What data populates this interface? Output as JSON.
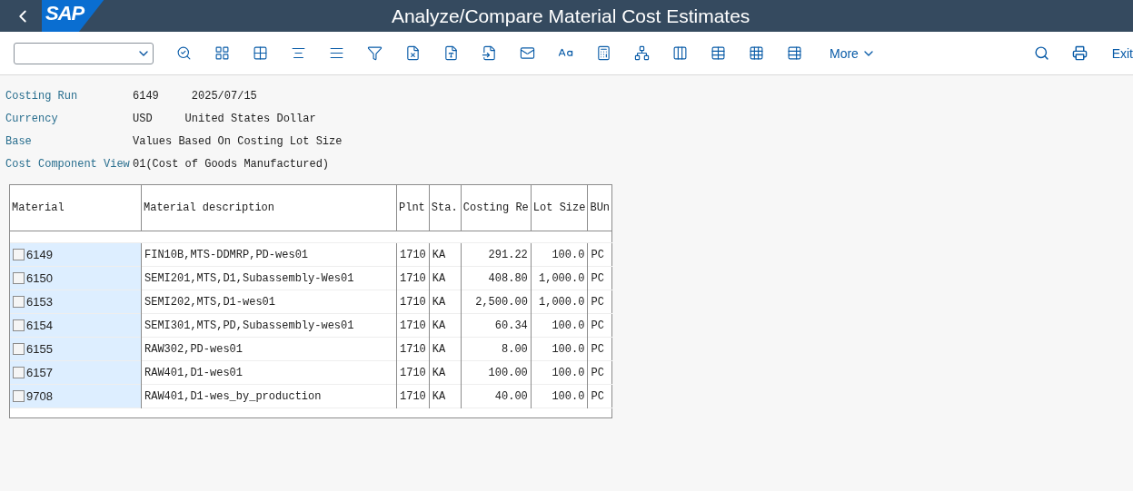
{
  "shell": {
    "title": "Analyze/Compare Material Cost Estimates",
    "logo": "SAP"
  },
  "toolbar": {
    "more": "More",
    "exit": "Exit"
  },
  "header": [
    {
      "label": "Costing Run",
      "values": [
        "6149",
        "2025/07/15"
      ]
    },
    {
      "label": "Currency",
      "values": [
        "USD",
        "United States Dollar"
      ]
    },
    {
      "label": "Base",
      "values": [
        "Values Based On Costing Lot Size"
      ]
    },
    {
      "label": "Cost Component View",
      "values": [
        "01(Cost of Goods Manufactured)"
      ]
    }
  ],
  "table": {
    "columns": [
      "Material",
      "Material description",
      "Plnt",
      "Sta.",
      "Costing Re",
      "Lot Size",
      "BUn"
    ],
    "rows": [
      {
        "checked": false,
        "cells": [
          "6149",
          "FIN10B,MTS-DDMRP,PD-wes01",
          "1710",
          "KA",
          "291.22",
          "100.0",
          "PC"
        ]
      },
      {
        "checked": false,
        "cells": [
          "6150",
          "SEMI201,MTS,D1,Subassembly-Wes01",
          "1710",
          "KA",
          "408.80",
          "1,000.0",
          "PC"
        ]
      },
      {
        "checked": false,
        "cells": [
          "6153",
          "SEMI202,MTS,D1-wes01",
          "1710",
          "KA",
          "2,500.00",
          "1,000.0",
          "PC"
        ]
      },
      {
        "checked": false,
        "cells": [
          "6154",
          "SEMI301,MTS,PD,Subassembly-wes01",
          "1710",
          "KA",
          "60.34",
          "100.0",
          "PC"
        ]
      },
      {
        "checked": false,
        "cells": [
          "6155",
          "RAW302,PD-wes01",
          "1710",
          "KA",
          "8.00",
          "100.0",
          "PC"
        ]
      },
      {
        "checked": false,
        "cells": [
          "6157",
          "RAW401,D1-wes01",
          "1710",
          "KA",
          "100.00",
          "100.0",
          "PC"
        ]
      },
      {
        "checked": false,
        "cells": [
          "9708",
          "RAW401,D1-wes_by_production",
          "1710",
          "KA",
          "40.00",
          "100.0",
          "PC"
        ]
      }
    ]
  }
}
